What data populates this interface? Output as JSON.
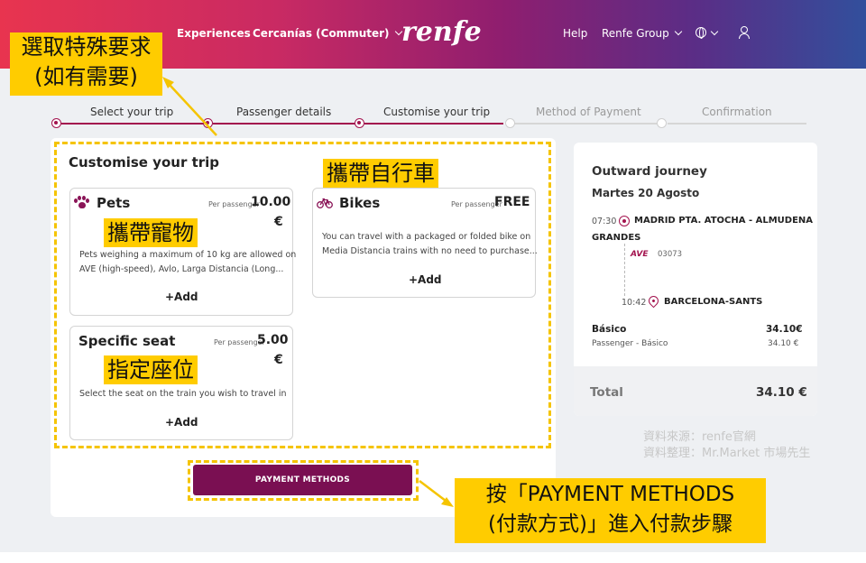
{
  "header": {
    "nav_left": [
      "Experiences",
      "Cercanías (Commuter)"
    ],
    "logo": "renfe",
    "nav_right": [
      "Help",
      "Renfe Group"
    ],
    "colors": {
      "gradient_start": "#e8344f",
      "gradient_end": "#324f9c"
    },
    "icons": [
      "chevron-down-icon",
      "globe-icon",
      "user-icon"
    ]
  },
  "stepper": {
    "steps": [
      {
        "label": "Select your trip",
        "state": "done"
      },
      {
        "label": "Passenger details",
        "state": "done"
      },
      {
        "label": "Customise your trip",
        "state": "current"
      },
      {
        "label": "Method of Payment",
        "state": "pending"
      },
      {
        "label": "Confirmation",
        "state": "pending"
      }
    ],
    "accent": "#a3134e"
  },
  "main": {
    "title": "Customise your trip",
    "cards": {
      "pets": {
        "icon": "paw-icon",
        "title": "Pets",
        "per": "Per passenger",
        "price": "10.00",
        "currency": "€",
        "desc_line1": "Pets weighing a maximum of 10 kg are allowed on",
        "desc_line2": "AVE (high-speed), Avlo, Larga Distancia (Long...",
        "add": "+Add"
      },
      "bikes": {
        "icon": "bicycle-icon",
        "title": "Bikes",
        "per": "Per passenger",
        "price": "FREE",
        "desc_line1": "You can travel with a packaged or folded bike on",
        "desc_line2": "Media Distancia trains with no need to purchase...",
        "add": "+Add"
      },
      "seat": {
        "title": "Specific seat",
        "per": "Per passenger",
        "price": "5.00",
        "currency": "€",
        "desc_line1": "Select the seat on the train you wish to travel in",
        "add": "+Add"
      }
    },
    "payment_button": "PAYMENT METHODS"
  },
  "journey": {
    "title": "Outward journey",
    "date": "Martes 20 Agosto",
    "departure_time": "07:30",
    "origin_line1": "MADRID PTA. ATOCHA - ALMUDENA",
    "origin_line2": "GRANDES",
    "train_brand": "AVE",
    "train_number": "03073",
    "arrival_time": "10:42",
    "destination": "BARCELONA-SANTS",
    "fare_name": "Básico",
    "fare_price": "34.10€",
    "passenger_fare": "Passenger - Básico",
    "passenger_price": "34.10 €",
    "total_label": "Total",
    "total_value": "34.10 €"
  },
  "annotations": {
    "special_requests_line1": "選取特殊要求",
    "special_requests_line2": "(如有需要)",
    "bike": "攜帶自行車",
    "pet": "攜帶寵物",
    "seat": "指定座位",
    "payment_line1": "按「PAYMENT METHODS",
    "payment_line2": "(付款方式)」進入付款步驟",
    "source": "資料來源：renfe官網",
    "compiled": "資料整理：Mr.Market 市場先生",
    "highlight_color": "#ffcc00"
  }
}
